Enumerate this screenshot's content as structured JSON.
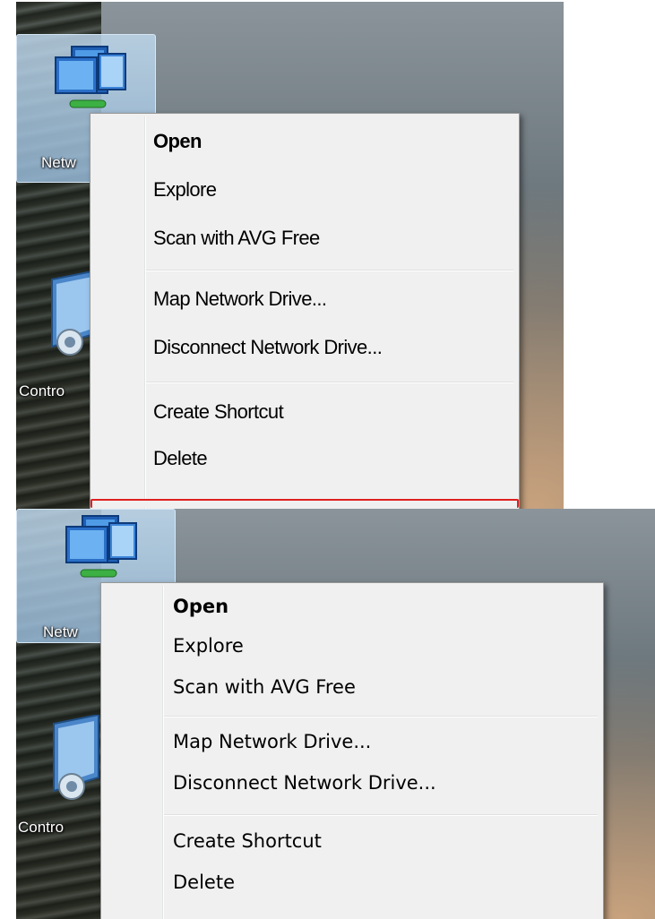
{
  "desktop": {
    "network_label": "Netw",
    "control_label": "Contro"
  },
  "context_menu": {
    "items": [
      {
        "label": "Open"
      },
      {
        "label": "Explore"
      },
      {
        "label": "Scan with AVG Free"
      },
      {
        "label": "Map Network Drive..."
      },
      {
        "label": "Disconnect Network Drive..."
      },
      {
        "label": "Create Shortcut"
      },
      {
        "label": "Delete"
      }
    ]
  },
  "colors": {
    "menu_bg": "#f0f0f0",
    "highlight_border": "#e02020",
    "icon_selection": "#9fc2de"
  },
  "icons": [
    "network-icon",
    "control-panel-icon"
  ]
}
